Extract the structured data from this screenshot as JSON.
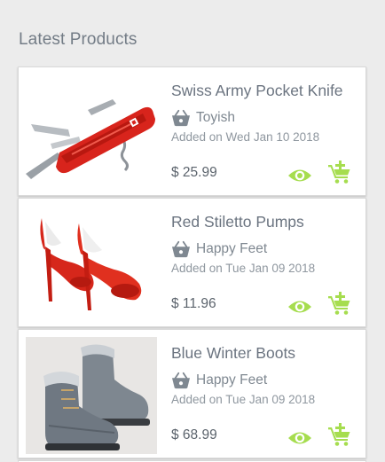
{
  "section": {
    "title": "Latest Products"
  },
  "colors": {
    "accent": "#a6dd4f",
    "text": "#6b7480"
  },
  "icons": {
    "vendor": "shopping-basket-icon",
    "view": "eye-icon",
    "cart": "add-to-cart-icon"
  },
  "products": [
    {
      "name": "Swiss Army Pocket Knife",
      "vendor": "Toyish",
      "added": "Added on Wed Jan 10 2018",
      "price": "$ 25.99"
    },
    {
      "name": "Red Stiletto Pumps",
      "vendor": "Happy Feet",
      "added": "Added on Tue Jan 09 2018",
      "price": "$ 11.96"
    },
    {
      "name": "Blue Winter Boots",
      "vendor": "Happy Feet",
      "added": "Added on Tue Jan 09 2018",
      "price": "$ 68.99"
    }
  ]
}
